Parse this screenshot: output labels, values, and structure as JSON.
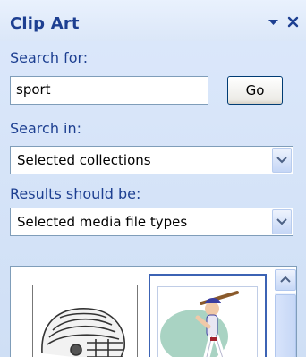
{
  "pane": {
    "title": "Clip Art",
    "dropdown_icon": "triangle-down-icon",
    "close_icon": "close-icon"
  },
  "search": {
    "label": "Search for:",
    "value": "sport",
    "go_label": "Go"
  },
  "search_in": {
    "label": "Search in:",
    "value": "Selected collections"
  },
  "results_type": {
    "label": "Results should be:",
    "value": "Selected media file types"
  },
  "results": {
    "items": [
      {
        "icon": "football-helmet-icon"
      },
      {
        "icon": "baseball-batter-icon"
      }
    ]
  },
  "colors": {
    "accent": "#1d3f91",
    "pane_bg": "#d6e3f7"
  }
}
